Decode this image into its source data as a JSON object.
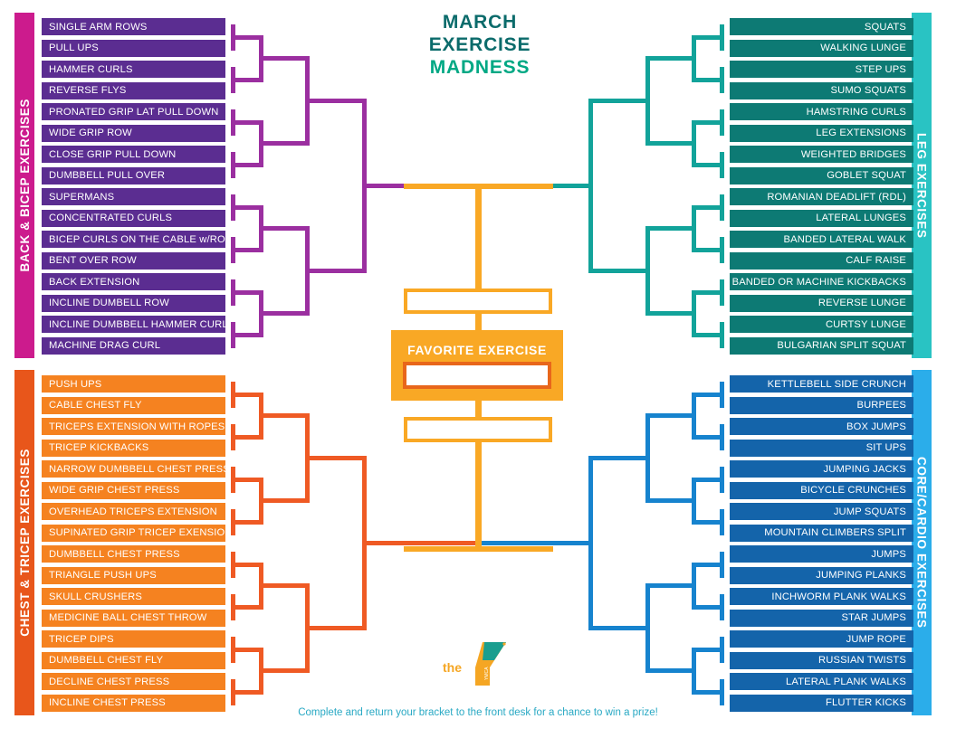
{
  "title": {
    "line1": "MARCH",
    "line2": "EXERCISE",
    "line3": "MADNESS"
  },
  "center": {
    "favorite_label": "FAVORITE EXERCISE",
    "favorite_value": "",
    "upper_semifinal_value": "",
    "lower_semifinal_value": ""
  },
  "footer": {
    "text": "Complete and return your bracket to the front desk for a chance to win a prize!"
  },
  "logo": {
    "the": "the",
    "mark": "ymca-y-logo",
    "wordmark": "YMCA"
  },
  "colors": {
    "back_bicep_rail": "#cc1b8d",
    "back_bicep_bar": "#5b2d91",
    "back_bicep_line": "#9b2fa0",
    "leg_rail": "#29c3c3",
    "leg_bar": "#0d7a74",
    "leg_line": "#12a39a",
    "chest_tricep_rail": "#e8561b",
    "chest_tricep_bar": "#f58220",
    "chest_tricep_line": "#ef5a24",
    "core_cardio_rail": "#2badea",
    "core_cardio_bar": "#1464aa",
    "core_cardio_line": "#1683ce",
    "center_orange": "#f9a825",
    "center_inner_orange": "#e8661b",
    "title_dark": "#0b6b6b",
    "title_green": "#00a884",
    "footer_text": "#29a9c4"
  },
  "quadrants": [
    {
      "id": "back-bicep",
      "label": "BACK & BICEP EXERCISES",
      "side": "left",
      "exercises": [
        "SINGLE ARM ROWS",
        "PULL UPS",
        "HAMMER CURLS",
        "REVERSE FLYS",
        "PRONATED GRIP LAT PULL DOWN",
        "WIDE GRIP ROW",
        "CLOSE GRIP PULL DOWN",
        "DUMBBELL PULL OVER",
        "SUPERMANS",
        "CONCENTRATED CURLS",
        "BICEP  CURLS  ON  THE  CABLE  w/ROPE",
        "BENT OVER ROW",
        "BACK EXTENSION",
        "INCLINE DUMBELL ROW",
        "INCLINE DUMBBELL HAMMER CURL SMITH",
        "MACHINE DRAG CURL"
      ]
    },
    {
      "id": "leg",
      "label": "LEG EXERCISES",
      "side": "right",
      "exercises": [
        "SQUATS",
        "WALKING LUNGE",
        "STEP UPS",
        "SUMO SQUATS",
        "HAMSTRING CURLS",
        "LEG EXTENSIONS",
        "WEIGHTED BRIDGES",
        "GOBLET SQUAT",
        "ROMANIAN DEADLIFT (RDL)",
        "LATERAL LUNGES",
        "BANDED LATERAL WALK",
        "CALF RAISE",
        "BANDED OR MACHINE KICKBACKS",
        "REVERSE LUNGE",
        "CURTSY LUNGE",
        "BULGARIAN SPLIT SQUAT"
      ]
    },
    {
      "id": "chest-tricep",
      "label": "CHEST & TRICEP EXERCISES",
      "side": "left",
      "exercises": [
        "PUSH UPS",
        "CABLE CHEST FLY",
        "TRICEPS EXTENSION WITH ROPES",
        "TRICEP KICKBACKS",
        "NARROW  DUMBBELL  CHEST  PRESS",
        "WIDE GRIP CHEST PRESS",
        "OVERHEAD TRICEPS EXTENSION",
        "SUPINATED GRIP TRICEP EXENSION",
        "DUMBBELL CHEST PRESS",
        "TRIANGLE PUSH UPS",
        "SKULL CRUSHERS",
        "MEDICINE BALL CHEST THROW",
        "TRICEP DIPS",
        "DUMBBELL CHEST FLY",
        "DECLINE CHEST PRESS",
        "INCLINE CHEST PRESS"
      ]
    },
    {
      "id": "core-cardio",
      "label": "CORE/CARDIO EXERCISES",
      "side": "right",
      "exercises": [
        "KETTLEBELL SIDE CRUNCH",
        "BURPEES",
        "BOX JUMPS",
        "SIT UPS",
        "JUMPING JACKS",
        "BICYCLE CRUNCHES",
        "JUMP SQUATS",
        "MOUNTAIN CLIMBERS SPLIT",
        "JUMPS",
        "JUMPING PLANKS",
        "INCHWORM PLANK WALKS",
        "STAR JUMPS",
        "JUMP ROPE",
        "RUSSIAN TWISTS",
        "LATERAL PLANK WALKS",
        "FLUTTER KICKS"
      ]
    }
  ]
}
